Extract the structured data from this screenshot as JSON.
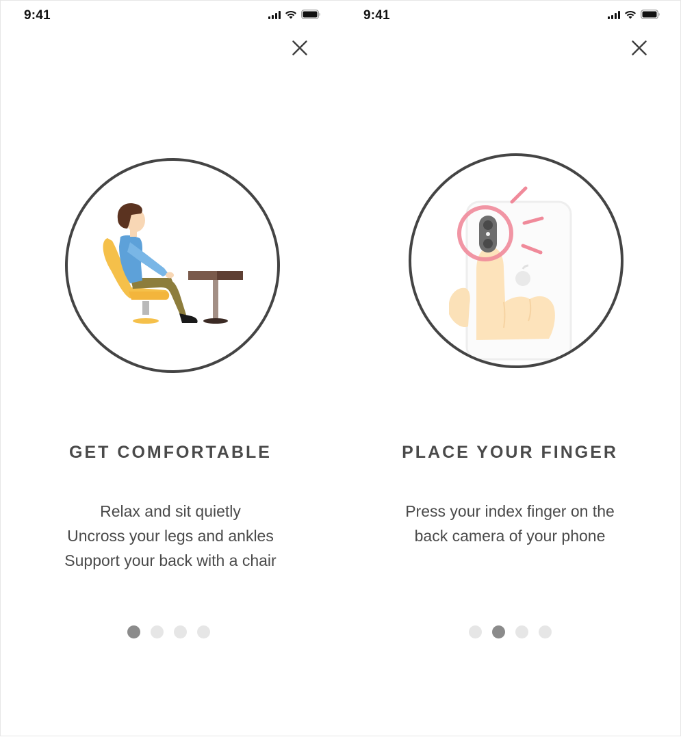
{
  "screens": [
    {
      "status_time": "9:41",
      "title": "GET COMFORTABLE",
      "lines": [
        "Relax and sit quietly",
        "Uncross your legs and ankles",
        "Support your back with a chair"
      ],
      "page_total": 4,
      "page_active": 1,
      "illustration": "person-sitting-at-table-illustration"
    },
    {
      "status_time": "9:41",
      "title": "PLACE YOUR FINGER",
      "lines": [
        "Press your index finger on the",
        "back camera of your phone"
      ],
      "page_total": 4,
      "page_active": 2,
      "illustration": "finger-on-camera-illustration"
    }
  ],
  "colors": {
    "text": "#4a4a4a",
    "dot_active": "#8b8b8b",
    "dot_inactive": "#e6e6e6",
    "ring": "#444444",
    "camera_highlight": "#f08a9a"
  },
  "icons": [
    "signal-icon",
    "wifi-icon",
    "battery-icon",
    "close-icon"
  ]
}
